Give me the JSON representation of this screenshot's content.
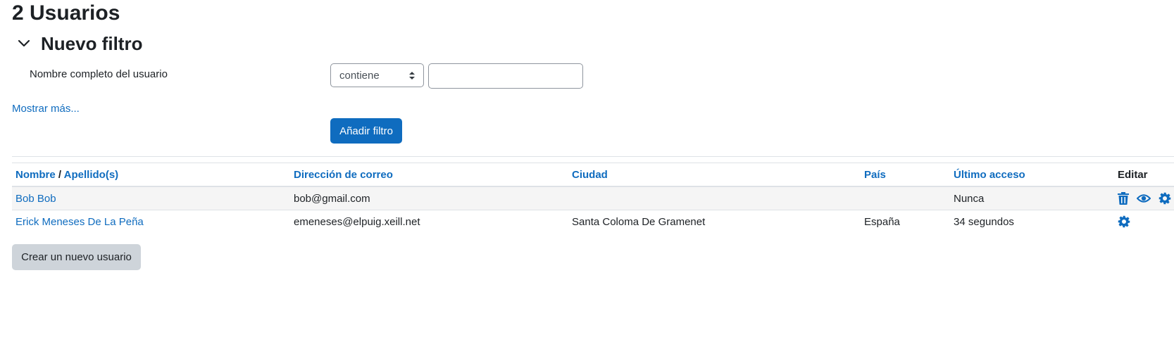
{
  "page": {
    "title": "2 Usuarios"
  },
  "filter": {
    "heading": "Nuevo filtro",
    "field_label": "Nombre completo del usuario",
    "operator_selected": "contiene",
    "value": "",
    "show_more": "Mostrar más...",
    "add_button": "Añadir filtro"
  },
  "table": {
    "headers": {
      "first_name": "Nombre",
      "separator": "/",
      "last_name": "Apellido(s)",
      "email": "Dirección de correo",
      "city": "Ciudad",
      "country": "País",
      "last_access": "Último acceso",
      "edit": "Editar"
    },
    "rows": [
      {
        "name": "Bob Bob",
        "email": "bob@gmail.com",
        "city": "",
        "country": "",
        "last_access": "Nunca",
        "actions": [
          "trash-icon",
          "eye-icon",
          "gear-icon"
        ]
      },
      {
        "name": "Erick Meneses De La Peña",
        "email": "emeneses@elpuig.xeill.net",
        "city": "Santa Coloma De Gramenet",
        "country": "España",
        "last_access": "34 segundos",
        "actions": [
          "gear-icon"
        ]
      }
    ]
  },
  "create_button": "Crear un nuevo usuario",
  "colors": {
    "link": "#0f6cbf",
    "primary": "#0f6cbf",
    "secondary": "#ced4da",
    "text": "#1d2125"
  }
}
